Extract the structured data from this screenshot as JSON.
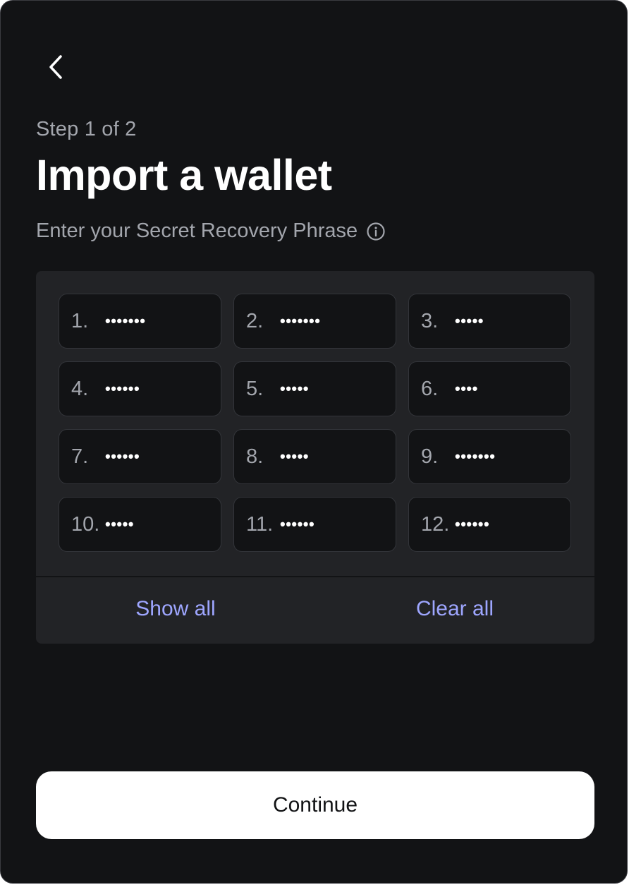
{
  "header": {
    "back_icon": "chevron-left-icon",
    "step_label": "Step 1 of 2",
    "title": "Import a wallet",
    "instruction": "Enter your Secret Recovery Phrase",
    "info_icon": "info-circle-icon"
  },
  "phrase": {
    "words": [
      {
        "number": "1.",
        "masked": "•••••••"
      },
      {
        "number": "2.",
        "masked": "•••••••"
      },
      {
        "number": "3.",
        "masked": "•••••"
      },
      {
        "number": "4.",
        "masked": "••••••"
      },
      {
        "number": "5.",
        "masked": "•••••"
      },
      {
        "number": "6.",
        "masked": "••••"
      },
      {
        "number": "7.",
        "masked": "••••••"
      },
      {
        "number": "8.",
        "masked": "•••••"
      },
      {
        "number": "9.",
        "masked": "•••••••"
      },
      {
        "number": "10.",
        "masked": "•••••"
      },
      {
        "number": "11.",
        "masked": "••••••"
      },
      {
        "number": "12.",
        "masked": "••••••"
      }
    ],
    "show_all_label": "Show all",
    "clear_all_label": "Clear all"
  },
  "footer": {
    "continue_label": "Continue"
  },
  "colors": {
    "background": "#121315",
    "panel": "#222326",
    "accent_link": "#9ea6ff",
    "primary_button": "#ffffff"
  }
}
